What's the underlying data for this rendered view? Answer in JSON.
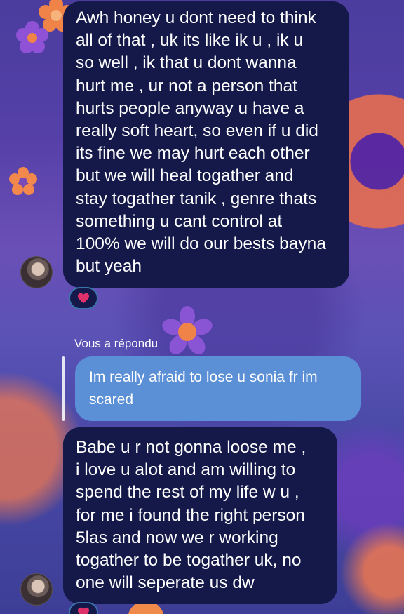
{
  "messages": [
    {
      "sender": "other",
      "lines": [
        "Awh honey u dont need to think",
        "all of that , uk its like ik u , ik u",
        "so well , ik that u dont wanna",
        "hurt me , ur not a person that",
        "hurts people anyway u have a",
        "really soft heart, so even if u did",
        "its fine we may hurt each other",
        "but we will heal togather and",
        "stay togather tanik , genre thats",
        "something u cant control at",
        "100% we will do our bests bayna",
        "but yeah"
      ],
      "reaction": "heart"
    },
    {
      "sender": "me",
      "reply_label": "Vous a répondu",
      "lines": [
        "Im really afraid to lose u sonia fr im",
        "scared"
      ]
    },
    {
      "sender": "other",
      "lines": [
        "Babe u r not gonna loose me ,",
        "i love u alot and am willing to",
        "spend the rest of my life w u ,",
        "for me i found the right person",
        "5las and now we r working",
        "togather to be togather uk, no",
        "one will seperate us dw"
      ],
      "reaction": "heart"
    }
  ],
  "colors": {
    "dark_bubble": "#14194a",
    "reply_bubble": "#5b8fd6",
    "reaction_heart": "#e0306a",
    "flower_orange": "#ef7b45",
    "flower_purple": "#8b4fd0"
  }
}
